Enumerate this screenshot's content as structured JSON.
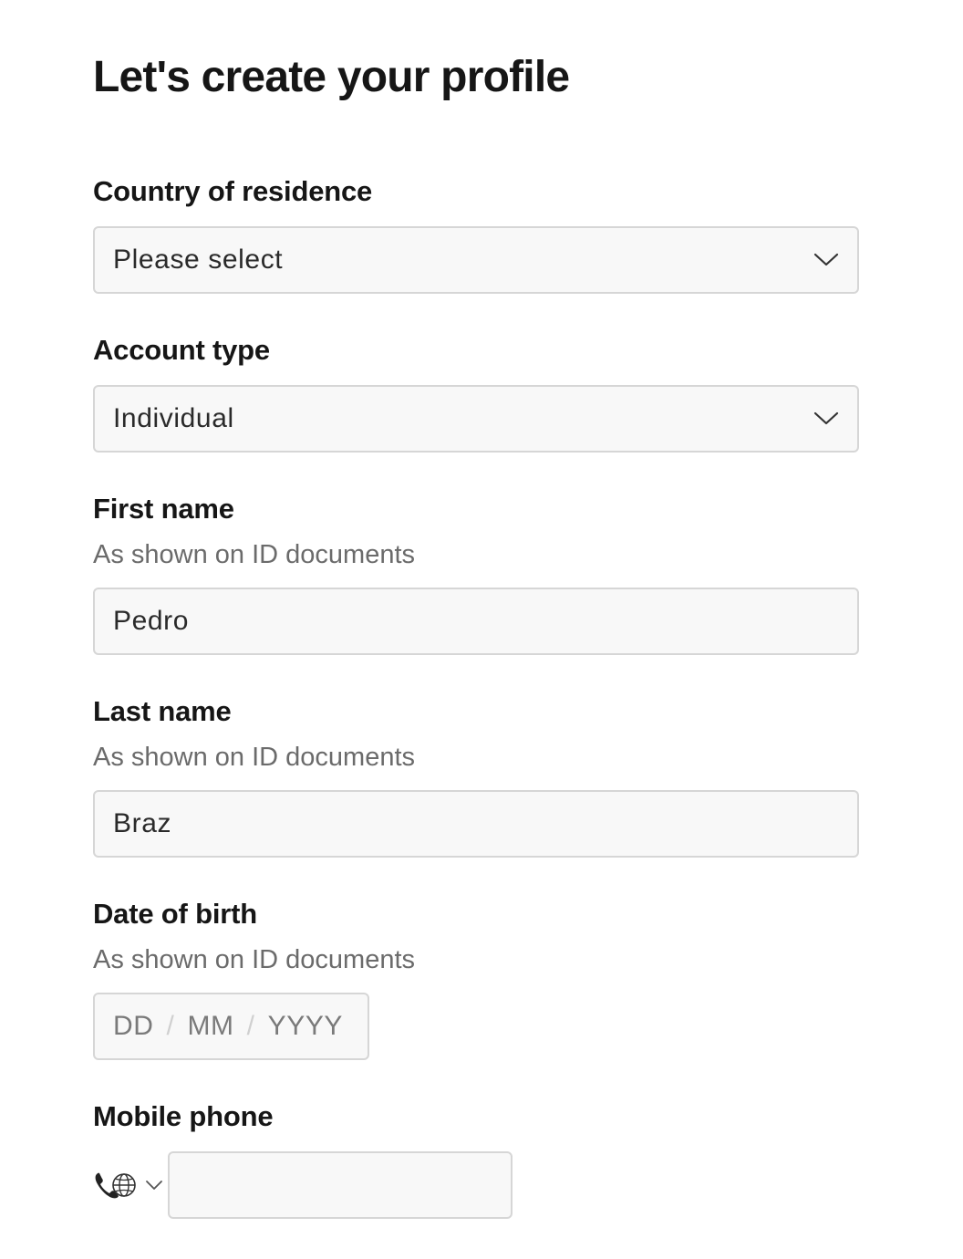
{
  "header": {
    "title": "Let's create your profile"
  },
  "form": {
    "country": {
      "label": "Country of residence",
      "value": "Please select"
    },
    "account_type": {
      "label": "Account type",
      "value": "Individual"
    },
    "first_name": {
      "label": "First name",
      "hint": "As shown on ID documents",
      "value": "Pedro"
    },
    "last_name": {
      "label": "Last name",
      "hint": "As shown on ID documents",
      "value": "Braz"
    },
    "dob": {
      "label": "Date of birth",
      "hint": "As shown on ID documents",
      "day_placeholder": "DD",
      "month_placeholder": "MM",
      "year_placeholder": "YYYY",
      "separator": "/"
    },
    "mobile": {
      "label": "Mobile phone",
      "country_icon": "phone-globe-icon",
      "value": ""
    }
  },
  "colors": {
    "text": "#161616",
    "hint": "#6b6b6b",
    "field_bg": "#f8f8f8",
    "field_border": "#d6d6d6"
  }
}
